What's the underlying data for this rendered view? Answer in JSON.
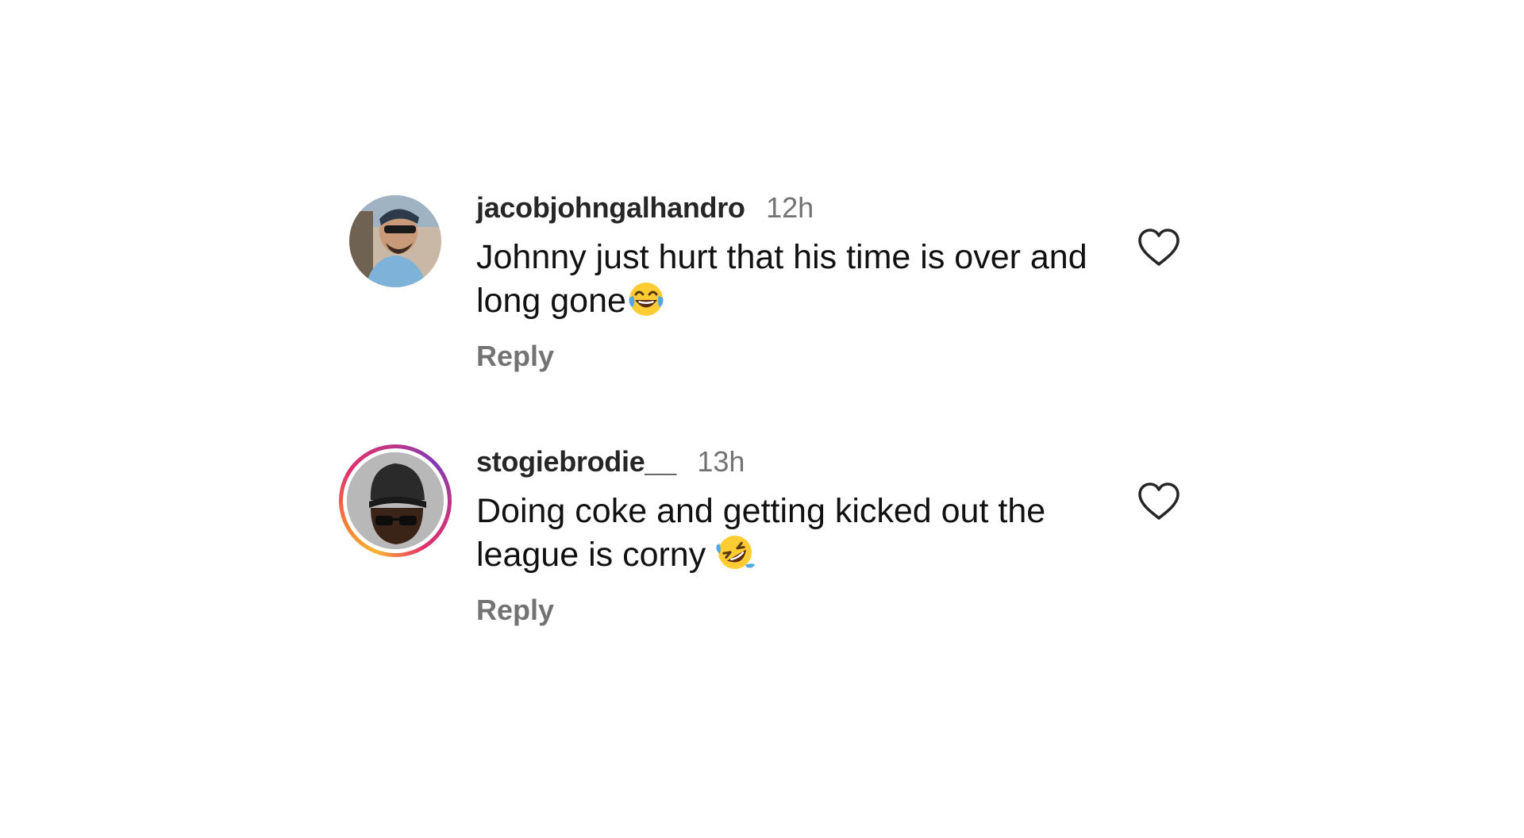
{
  "comments": [
    {
      "username": "jacobjohngalhandro",
      "time": "12h",
      "text": "Johnny just hurt that his time is over and long gone",
      "emoji": "face-with-tears-of-joy",
      "reply_label": "Reply",
      "has_story_ring": false
    },
    {
      "username": "stogiebrodie__",
      "time": "13h",
      "text": "Doing coke and getting kicked out the league is corny ",
      "emoji": "rolling-on-the-floor-laughing",
      "reply_label": "Reply",
      "has_story_ring": true
    }
  ],
  "colors": {
    "username": "#262626",
    "meta": "#737373",
    "text": "#111111",
    "ring_start": "#f9b233",
    "ring_end": "#833ab4"
  },
  "icons": {
    "like": "heart-outline-icon"
  }
}
